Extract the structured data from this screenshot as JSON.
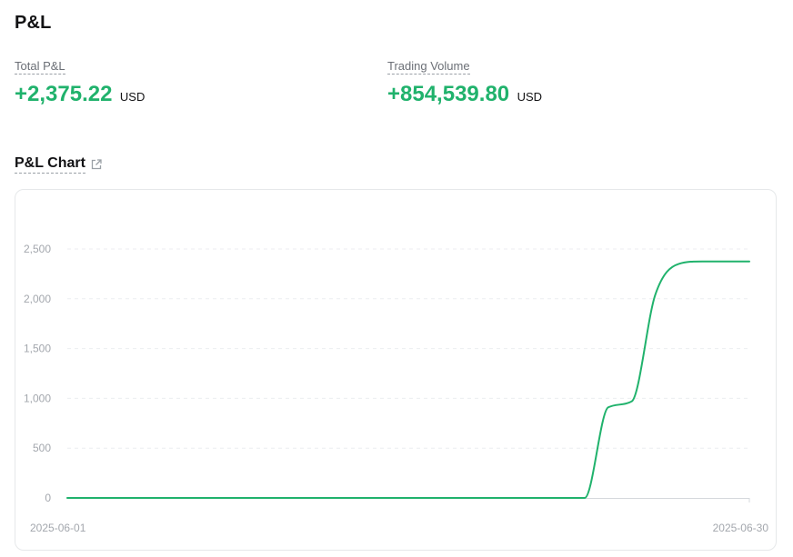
{
  "page": {
    "title": "P&L"
  },
  "stats": {
    "total_pnl": {
      "label": "Total P&L",
      "value": "+2,375.22",
      "unit": "USD"
    },
    "trading_volume": {
      "label": "Trading Volume",
      "value": "+854,539.80",
      "unit": "USD"
    }
  },
  "chart_section": {
    "title": "P&L Chart",
    "link_icon": "external-link-icon"
  },
  "colors": {
    "positive": "#20b26c",
    "line": "#20b26c",
    "grid": "#eceef0",
    "axis_text": "#a3a7ad"
  },
  "chart_data": {
    "type": "line",
    "title": "",
    "xlabel": "",
    "ylabel": "",
    "x_tick_labels": [
      "2025-06-01",
      "2025-06-30"
    ],
    "y_ticks": [
      0,
      500,
      1000,
      1500,
      2000,
      2500
    ],
    "y_tick_labels": [
      "0",
      "500",
      "1,000",
      "1,500",
      "2,000",
      "2,500"
    ],
    "ylim": [
      0,
      2500
    ],
    "grid": true,
    "legend": "none",
    "x": [
      "2025-06-01",
      "2025-06-02",
      "2025-06-03",
      "2025-06-04",
      "2025-06-05",
      "2025-06-06",
      "2025-06-07",
      "2025-06-08",
      "2025-06-09",
      "2025-06-10",
      "2025-06-11",
      "2025-06-12",
      "2025-06-13",
      "2025-06-14",
      "2025-06-15",
      "2025-06-16",
      "2025-06-17",
      "2025-06-18",
      "2025-06-19",
      "2025-06-20",
      "2025-06-21",
      "2025-06-22",
      "2025-06-23",
      "2025-06-24",
      "2025-06-25",
      "2025-06-26",
      "2025-06-27",
      "2025-06-28",
      "2025-06-29",
      "2025-06-30"
    ],
    "series": [
      {
        "values": [
          0,
          0,
          0,
          0,
          0,
          0,
          0,
          0,
          0,
          0,
          0,
          0,
          0,
          0,
          0,
          0,
          0,
          0,
          0,
          0,
          0,
          0,
          0,
          910,
          970,
          2040,
          2350,
          2375,
          2375,
          2375
        ]
      }
    ]
  }
}
